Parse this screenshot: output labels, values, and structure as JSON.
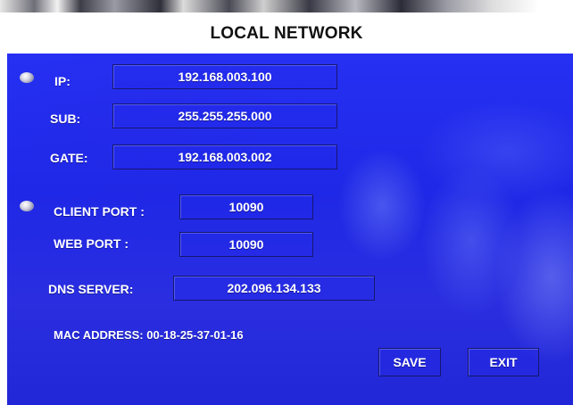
{
  "title": "LOCAL NETWORK",
  "ip_section": {
    "ip_label": "IP:",
    "ip_value": "192.168.003.100",
    "sub_label": "SUB:",
    "sub_value": "255.255.255.000",
    "gate_label": "GATE:",
    "gate_value": "192.168.003.002"
  },
  "port_section": {
    "client_port_label": "CLIENT PORT :",
    "client_port_value": "10090",
    "web_port_label": "WEB PORT :",
    "web_port_value": "10090"
  },
  "dns": {
    "label": "DNS SERVER:",
    "value": "202.096.134.133"
  },
  "mac_address": "MAC ADDRESS: 00-18-25-37-01-16",
  "buttons": {
    "save": "SAVE",
    "exit": "EXIT"
  }
}
